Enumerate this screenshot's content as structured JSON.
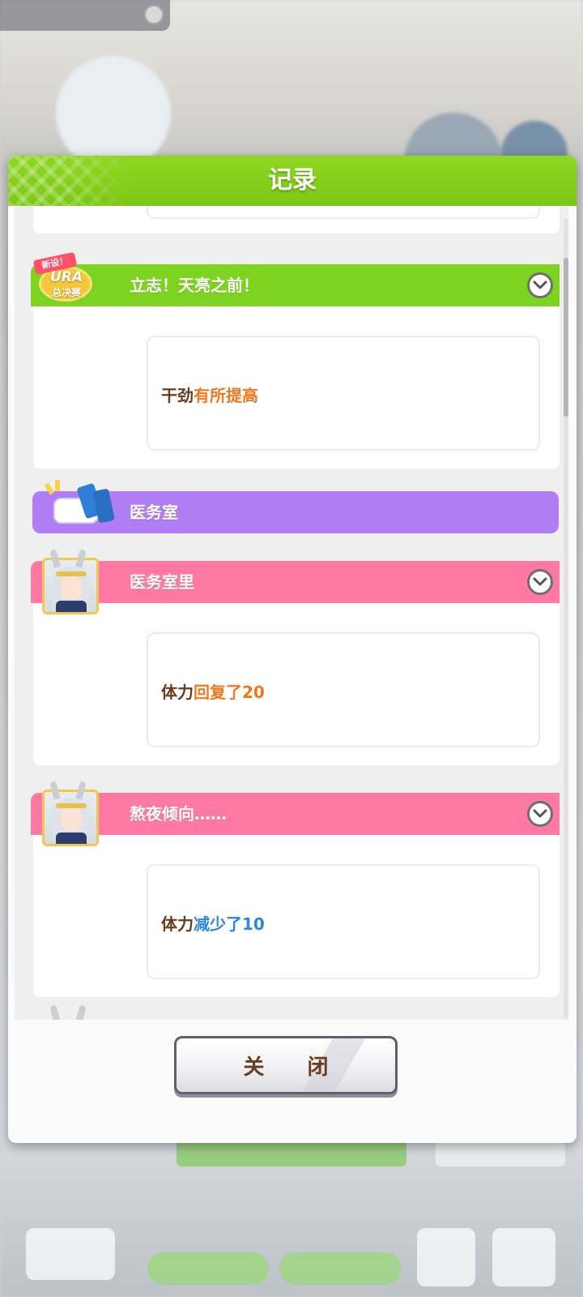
{
  "dialog": {
    "title": "记录",
    "close_label": "关 闭"
  },
  "entries": [
    {
      "title": "立志！天亮之前！",
      "badge": {
        "top": "新设！",
        "middle": "URA",
        "bottom": "总决赛"
      },
      "effect": {
        "label": "干劲",
        "change": "有所提高"
      }
    },
    {
      "title": "医务室"
    },
    {
      "title": "医务室里",
      "effect": {
        "label": "体力",
        "change": "回复了20"
      }
    },
    {
      "title": "熬夜倾向……",
      "effect": {
        "label": "体力",
        "change": "减少了10"
      }
    }
  ],
  "colors": {
    "header_green": "#7ed321",
    "event_pink": "#ff79a2",
    "section_purple": "#b07df4",
    "increase_orange": "#f07820",
    "decrease_blue": "#2d86e6",
    "label_brown": "#6a3b1d"
  }
}
